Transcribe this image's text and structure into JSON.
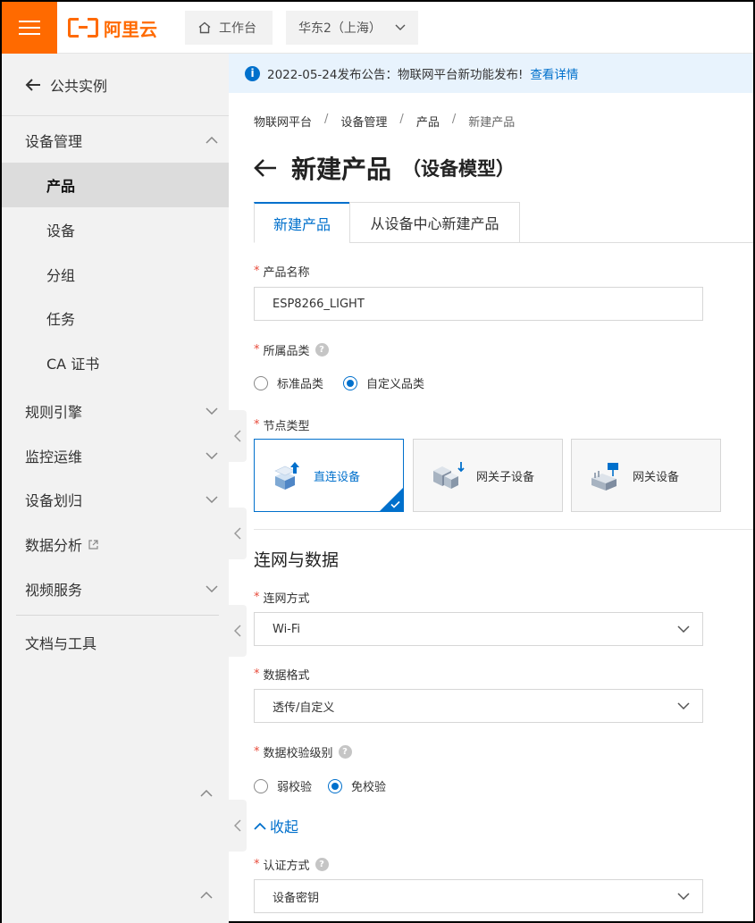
{
  "topbar": {
    "logo_text": "阿里云",
    "home_label": "工作台",
    "region_label": "华东2（上海）"
  },
  "sidebar": {
    "back_label": "公共实例",
    "group_device": "设备管理",
    "sub_items": [
      {
        "label": "产品"
      },
      {
        "label": "设备"
      },
      {
        "label": "分组"
      },
      {
        "label": "任务"
      },
      {
        "label": "CA 证书"
      }
    ],
    "groups": [
      {
        "label": "规则引擎"
      },
      {
        "label": "监控运维"
      },
      {
        "label": "设备划归"
      },
      {
        "label": "数据分析"
      },
      {
        "label": "视频服务"
      }
    ],
    "docs_label": "文档与工具"
  },
  "notice": {
    "text": "2022-05-24发布公告：物联网平台新功能发布!",
    "link": "查看详情"
  },
  "breadcrumb": [
    "物联网平台",
    "设备管理",
    "产品",
    "新建产品"
  ],
  "page": {
    "title": "新建产品",
    "subtitle": "（设备模型）"
  },
  "tabs": [
    "新建产品",
    "从设备中心新建产品"
  ],
  "form": {
    "product_name_label": "产品名称",
    "product_name_value": "ESP8266_LIGHT",
    "category_label": "所属品类",
    "category_options": [
      "标准品类",
      "自定义品类"
    ],
    "node_type_label": "节点类型",
    "node_types": [
      "直连设备",
      "网关子设备",
      "网关设备"
    ],
    "section_title": "连网与数据",
    "network_label": "连网方式",
    "network_value": "Wi-Fi",
    "data_format_label": "数据格式",
    "data_format_value": "透传/自定义",
    "check_level_label": "数据校验级别",
    "check_options": [
      "弱校验",
      "免校验"
    ],
    "collapse_label": "收起",
    "auth_label": "认证方式",
    "auth_value": "设备密钥"
  },
  "colors": {
    "brand_orange": "#ff6a00",
    "accent_blue": "#0070cc",
    "required_red": "#e84a3a"
  }
}
